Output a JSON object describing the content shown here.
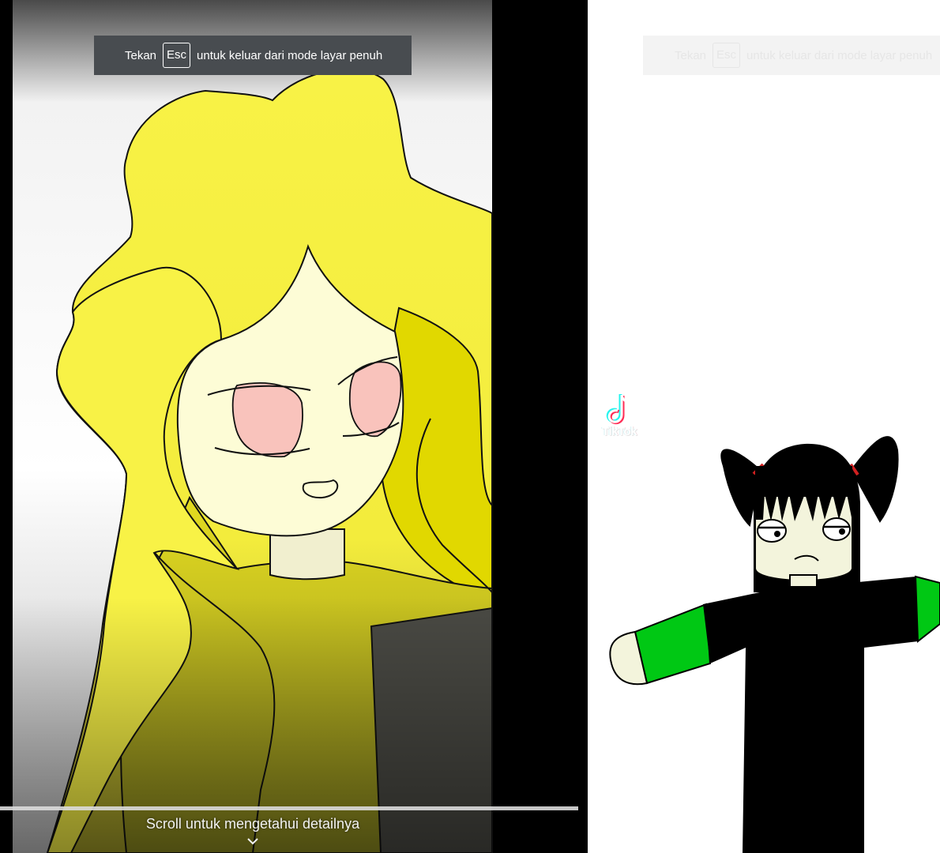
{
  "left_panel": {
    "esc_prefix": "Tekan",
    "esc_key": "Esc",
    "esc_suffix": "untuk keluar dari mode layar penuh",
    "scroll_hint": "Scroll untuk mengetahui detailnya",
    "video_progress": 1.0
  },
  "right_panel": {
    "esc_prefix": "Tekan",
    "esc_key": "Esc",
    "esc_suffix": "untuk keluar dari mode layar penuh",
    "watermark_text": "TikTok"
  },
  "icons": {
    "scroll_down": "chevron-down-icon",
    "watermark_logo": "tiktok-logo-icon"
  },
  "colors": {
    "hair_yellow": "#f8f246",
    "skin": "#fdfcd6",
    "eyes_pink": "#f9c3bc",
    "sleeve_green": "#00c814",
    "toast_bg": "#484c50"
  }
}
